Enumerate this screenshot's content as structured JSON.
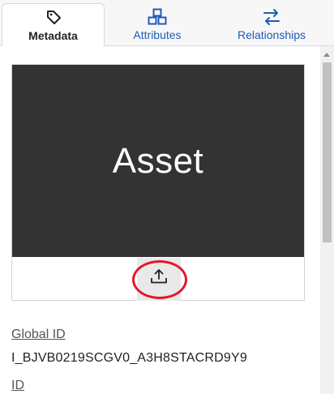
{
  "tabs": [
    {
      "label": "Metadata",
      "icon": "tag-icon",
      "active": true
    },
    {
      "label": "Attributes",
      "icon": "cubes-icon",
      "active": false
    },
    {
      "label": "Relationships",
      "icon": "swap-arrows-icon",
      "active": false
    }
  ],
  "preview": {
    "image_text": "Asset",
    "upload_icon": "upload-icon",
    "highlight_color": "#e3172c"
  },
  "fields": [
    {
      "label": "Global ID",
      "value": "I_BJVB0219SCGV0_A3H8STACRD9Y9"
    },
    {
      "label": "ID",
      "value": ""
    }
  ],
  "colors": {
    "accent": "#1f5bb8",
    "preview_bg": "#333333"
  }
}
